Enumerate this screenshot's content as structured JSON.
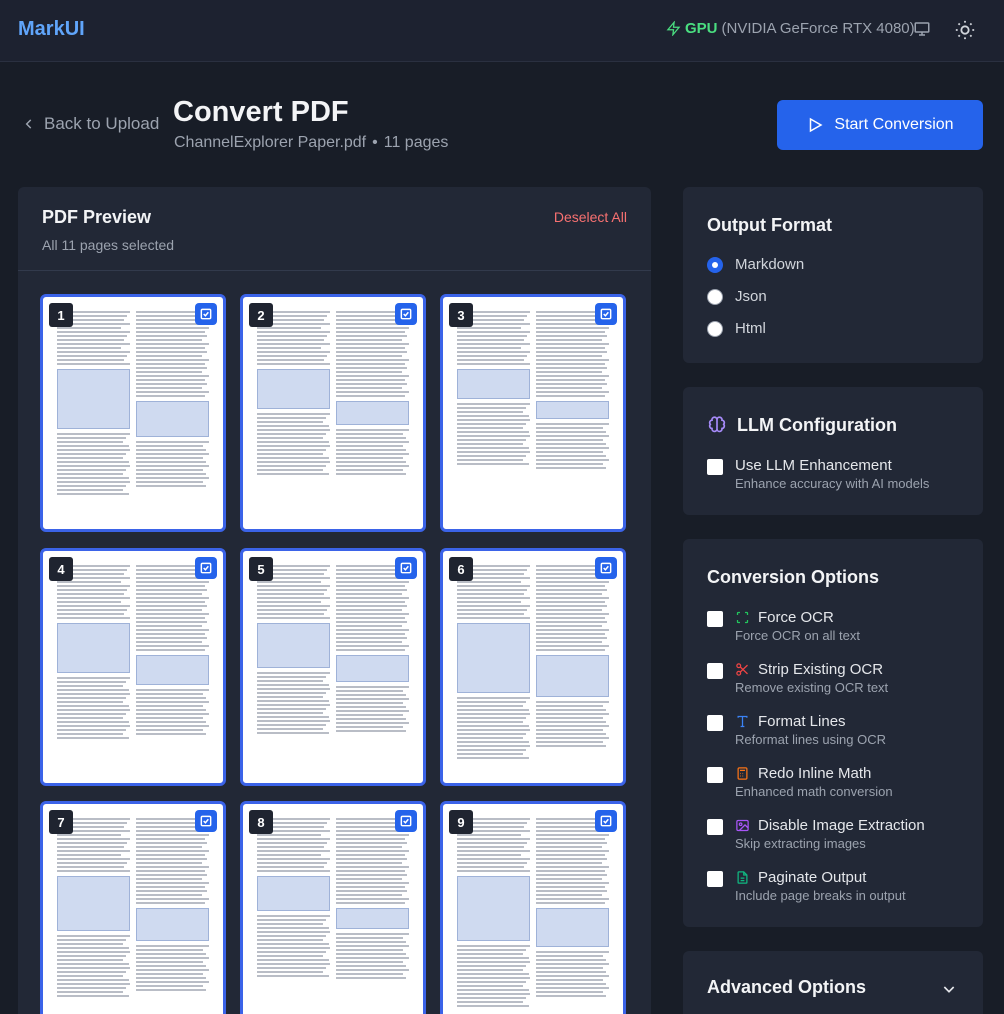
{
  "app": {
    "brand": "MarkUI"
  },
  "gpu": {
    "label": "GPU",
    "detail": "(NVIDIA GeForce RTX 4080)"
  },
  "header": {
    "back_label": "Back to Upload",
    "title": "Convert PDF",
    "filename": "ChannelExplorer Paper.pdf",
    "separator": "•",
    "page_count": "11 pages",
    "start_label": "Start Conversion"
  },
  "preview": {
    "title": "PDF Preview",
    "subtitle": "All 11 pages selected",
    "deselect_label": "Deselect All",
    "pages": [
      {
        "num": "1"
      },
      {
        "num": "2"
      },
      {
        "num": "3"
      },
      {
        "num": "4"
      },
      {
        "num": "5"
      },
      {
        "num": "6"
      },
      {
        "num": "7"
      },
      {
        "num": "8"
      },
      {
        "num": "9"
      }
    ]
  },
  "output_format": {
    "title": "Output Format",
    "options": [
      "Markdown",
      "Json",
      "Html"
    ],
    "selected": "Markdown"
  },
  "llm": {
    "title": "LLM Configuration",
    "option_label": "Use LLM Enhancement",
    "option_desc": "Enhance accuracy with AI models"
  },
  "conversion": {
    "title": "Conversion Options",
    "options": [
      {
        "label": "Force OCR",
        "desc": "Force OCR on all text",
        "icon": "scan-icon",
        "color": "#22c55e"
      },
      {
        "label": "Strip Existing OCR",
        "desc": "Remove existing OCR text",
        "icon": "scissors-icon",
        "color": "#ef4444"
      },
      {
        "label": "Format Lines",
        "desc": "Reformat lines using OCR",
        "icon": "type-icon",
        "color": "#3b82f6"
      },
      {
        "label": "Redo Inline Math",
        "desc": "Enhanced math conversion",
        "icon": "calculator-icon",
        "color": "#f97316"
      },
      {
        "label": "Disable Image Extraction",
        "desc": "Skip extracting images",
        "icon": "image-icon",
        "color": "#a855f7"
      },
      {
        "label": "Paginate Output",
        "desc": "Include page breaks in output",
        "icon": "file-text-icon",
        "color": "#10b981"
      }
    ]
  },
  "advanced": {
    "title": "Advanced Options"
  },
  "colors": {
    "accent": "#2563eb",
    "danger": "#f87171",
    "brand": "#60a5fa",
    "gpu": "#4ade80"
  }
}
